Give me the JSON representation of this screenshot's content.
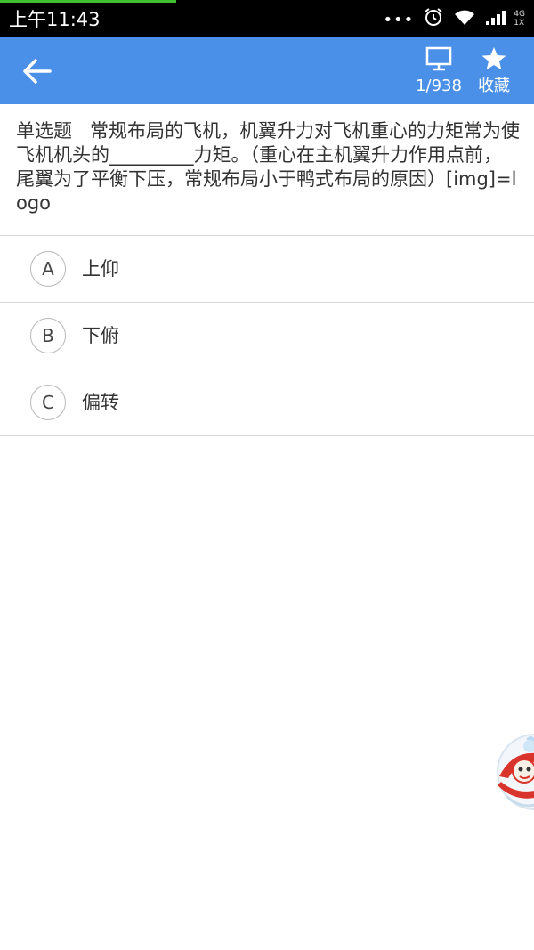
{
  "status_bar": {
    "time": "上午11:43",
    "network_type": "4G",
    "network_sub": "1X"
  },
  "app_bar": {
    "progress_label": "1/938",
    "favorite_label": "收藏",
    "accent_color": "#4a90e8"
  },
  "question": {
    "type": "单选题",
    "text": "常规布局的飞机，机翼升力对飞机重心的力矩常为使飞机机头的_________力矩。（重心在主机翼升力作用点前，尾翼为了平衡下压，常规布局小于鸭式布局的原因）[img]=logo"
  },
  "options": [
    {
      "letter": "A",
      "text": "上仰"
    },
    {
      "letter": "B",
      "text": "下俯"
    },
    {
      "letter": "C",
      "text": "偏转"
    }
  ],
  "icons": {
    "back": "arrow-left-icon",
    "progress": "monitor-icon",
    "favorite": "star-icon",
    "floating": "mascot-icon"
  }
}
